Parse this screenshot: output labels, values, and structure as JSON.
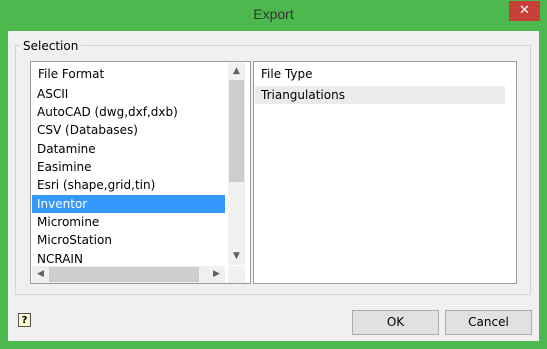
{
  "window": {
    "title": "Export",
    "close_symbol": "✕"
  },
  "selection": {
    "group_label": "Selection",
    "format_header": "File Format",
    "formats": [
      "ASCII",
      "AutoCAD (dwg,dxf,dxb)",
      "CSV (Databases)",
      "Datamine",
      "Easimine",
      "Esri (shape,grid,tin)",
      "Inventor",
      "Micromine",
      "MicroStation",
      "NCRAIN"
    ],
    "selected_format": "Inventor",
    "type_header": "File Type",
    "types": [
      "Triangulations"
    ]
  },
  "buttons": {
    "ok": "OK",
    "cancel": "Cancel",
    "help_symbol": "?"
  },
  "colors": {
    "titlebar": "#4db84e",
    "close": "#c8403a",
    "selection": "#3399ff"
  }
}
